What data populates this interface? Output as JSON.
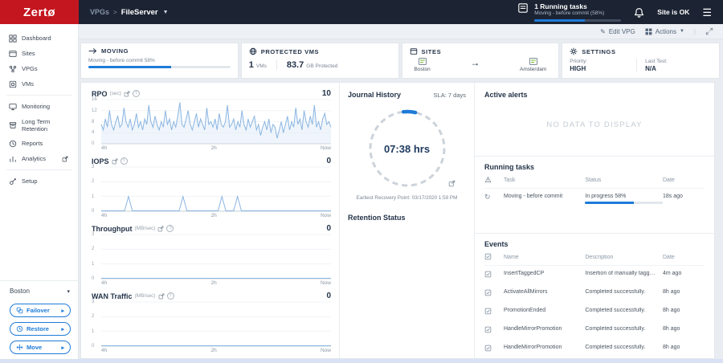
{
  "topbar": {
    "logo": "Zertø",
    "breadcrumb": {
      "section": "VPGs",
      "separator": ">",
      "current": "FileServer"
    },
    "running_tasks": {
      "title": "1 Running tasks",
      "subtitle": "Moving - before commit (58%)",
      "progress_pct": 58
    },
    "site_status": "Site is OK"
  },
  "toolbar": {
    "edit_vpg": "Edit VPG",
    "actions": "Actions"
  },
  "sidebar": {
    "items": [
      {
        "label": "Dashboard"
      },
      {
        "label": "Sites"
      },
      {
        "label": "VPGs"
      },
      {
        "label": "VMs"
      },
      {
        "label": "Monitoring"
      },
      {
        "label": "Long Term Retention"
      },
      {
        "label": "Reports"
      },
      {
        "label": "Analytics"
      },
      {
        "label": "Setup"
      }
    ],
    "site_selector": "Boston",
    "buttons": [
      {
        "label": "Failover"
      },
      {
        "label": "Restore"
      },
      {
        "label": "Move"
      }
    ]
  },
  "summary": {
    "moving": {
      "title": "MOVING",
      "status": "Moving - before commit 58%",
      "progress_pct": 58
    },
    "protected": {
      "title": "PROTECTED VMS",
      "vm_count": "1",
      "vm_unit": "VMs",
      "size": "83.7",
      "size_unit": "GB Protected"
    },
    "sites": {
      "title": "SITES",
      "source": "Boston",
      "target": "Amsterdam"
    },
    "settings": {
      "title": "SETTINGS",
      "priority_label": "Priority:",
      "priority": "HIGH",
      "last_test_label": "Last Test:",
      "last_test": "N/A"
    }
  },
  "journal": {
    "title": "Journal History",
    "sla": "SLA: 7 days",
    "value": "07:38 hrs",
    "earliest_label": "Earliest Recovery Point:",
    "earliest_value": "03/17/2020 1:59 PM",
    "retention_title": "Retention Status"
  },
  "alerts": {
    "title": "Active alerts",
    "empty": "NO DATA TO DISPLAY"
  },
  "running_tasks": {
    "title": "Running tasks",
    "columns": [
      "Task",
      "Status",
      "Date"
    ],
    "rows": [
      {
        "task": "Moving - before commit",
        "status": "In progress 58%",
        "progress_pct": 58,
        "date": "18s ago"
      }
    ]
  },
  "events": {
    "title": "Events",
    "columns": [
      "Name",
      "Description",
      "Date"
    ],
    "rows": [
      {
        "name": "InsertTaggedCP",
        "description": "Insertion of manually tagged checkpoint + For Move oper...",
        "date": "4m ago"
      },
      {
        "name": "ActivateAllMirrors",
        "description": "Completed successfully.",
        "date": "8h ago"
      },
      {
        "name": "PromotionEnded",
        "description": "Completed successfully.",
        "date": "8h ago"
      },
      {
        "name": "HandleMirrorPromotion",
        "description": "Completed successfully.",
        "date": "8h ago"
      },
      {
        "name": "HandleMirrorPromotion",
        "description": "Completed successfully.",
        "date": "8h ago"
      }
    ]
  },
  "colors": {
    "brand_red": "#c4161f",
    "accent_blue": "#1e7bd9",
    "navy": "#243449",
    "site_green": "#76b82a",
    "chart_line": "#8ab5e2"
  },
  "chart_data": [
    {
      "type": "line",
      "title": "RPO",
      "unit": "(sec)",
      "current_value": "10",
      "ylabel": "sec",
      "ylim": [
        0,
        16
      ],
      "yticks": [
        16,
        12,
        8,
        4,
        0
      ],
      "xticks": [
        "4h",
        "2h",
        "Now"
      ],
      "area": true,
      "values": [
        7,
        5,
        9,
        6,
        12,
        7,
        5,
        8,
        10,
        6,
        7,
        13,
        8,
        6,
        9,
        5,
        7,
        11,
        6,
        8,
        5,
        9,
        7,
        14,
        8,
        6,
        10,
        7,
        5,
        8,
        6,
        12,
        7,
        9,
        5,
        8,
        6,
        10,
        15,
        7,
        6,
        9,
        12,
        7,
        5,
        8,
        11,
        6,
        9,
        7,
        5,
        13,
        7,
        8,
        6,
        9,
        5,
        11,
        7,
        6,
        8,
        14,
        6,
        7,
        9,
        5,
        8,
        6,
        12,
        7,
        5,
        9,
        6,
        8,
        10,
        5,
        7,
        3,
        6,
        8,
        5,
        9,
        4,
        7,
        6,
        2,
        5,
        8,
        4,
        7,
        10,
        5,
        8,
        6,
        13,
        7,
        9,
        5,
        12,
        8,
        6,
        10,
        7,
        14,
        6,
        8,
        5,
        9,
        11,
        7,
        8,
        6
      ]
    },
    {
      "type": "line",
      "title": "IOPS",
      "unit": "",
      "current_value": "0",
      "ylabel": "",
      "ylim": [
        0,
        3
      ],
      "yticks": [
        3,
        2,
        1,
        0
      ],
      "xticks": [
        "4h",
        "2h",
        "Now"
      ],
      "area": false,
      "values": [
        0,
        0,
        0,
        0,
        0,
        0,
        0,
        1,
        0,
        0,
        0,
        0,
        0,
        0,
        0,
        0,
        0,
        0,
        0,
        0,
        0,
        1,
        0,
        0,
        0,
        0,
        0,
        0,
        0,
        0,
        0,
        1,
        0,
        0,
        0,
        1,
        0,
        0,
        0,
        0,
        0,
        0,
        0,
        0,
        0,
        0,
        0,
        0,
        0,
        0,
        0,
        0,
        0,
        0,
        0,
        0,
        0,
        0,
        0,
        0
      ]
    },
    {
      "type": "line",
      "title": "Throughput",
      "unit": "(MB/sec)",
      "current_value": "0",
      "ylabel": "MB/sec",
      "ylim": [
        0,
        3
      ],
      "yticks": [
        3,
        2,
        1,
        0
      ],
      "xticks": [
        "4h",
        "2h",
        "Now"
      ],
      "area": false,
      "values": [
        0,
        0
      ]
    },
    {
      "type": "line",
      "title": "WAN Traffic",
      "unit": "(MB/sec)",
      "current_value": "0",
      "ylabel": "MB/sec",
      "ylim": [
        0,
        3
      ],
      "yticks": [
        3,
        2,
        1,
        0
      ],
      "xticks": [
        "4h",
        "2h",
        "Now"
      ],
      "area": false,
      "values": [
        0,
        0
      ]
    }
  ]
}
